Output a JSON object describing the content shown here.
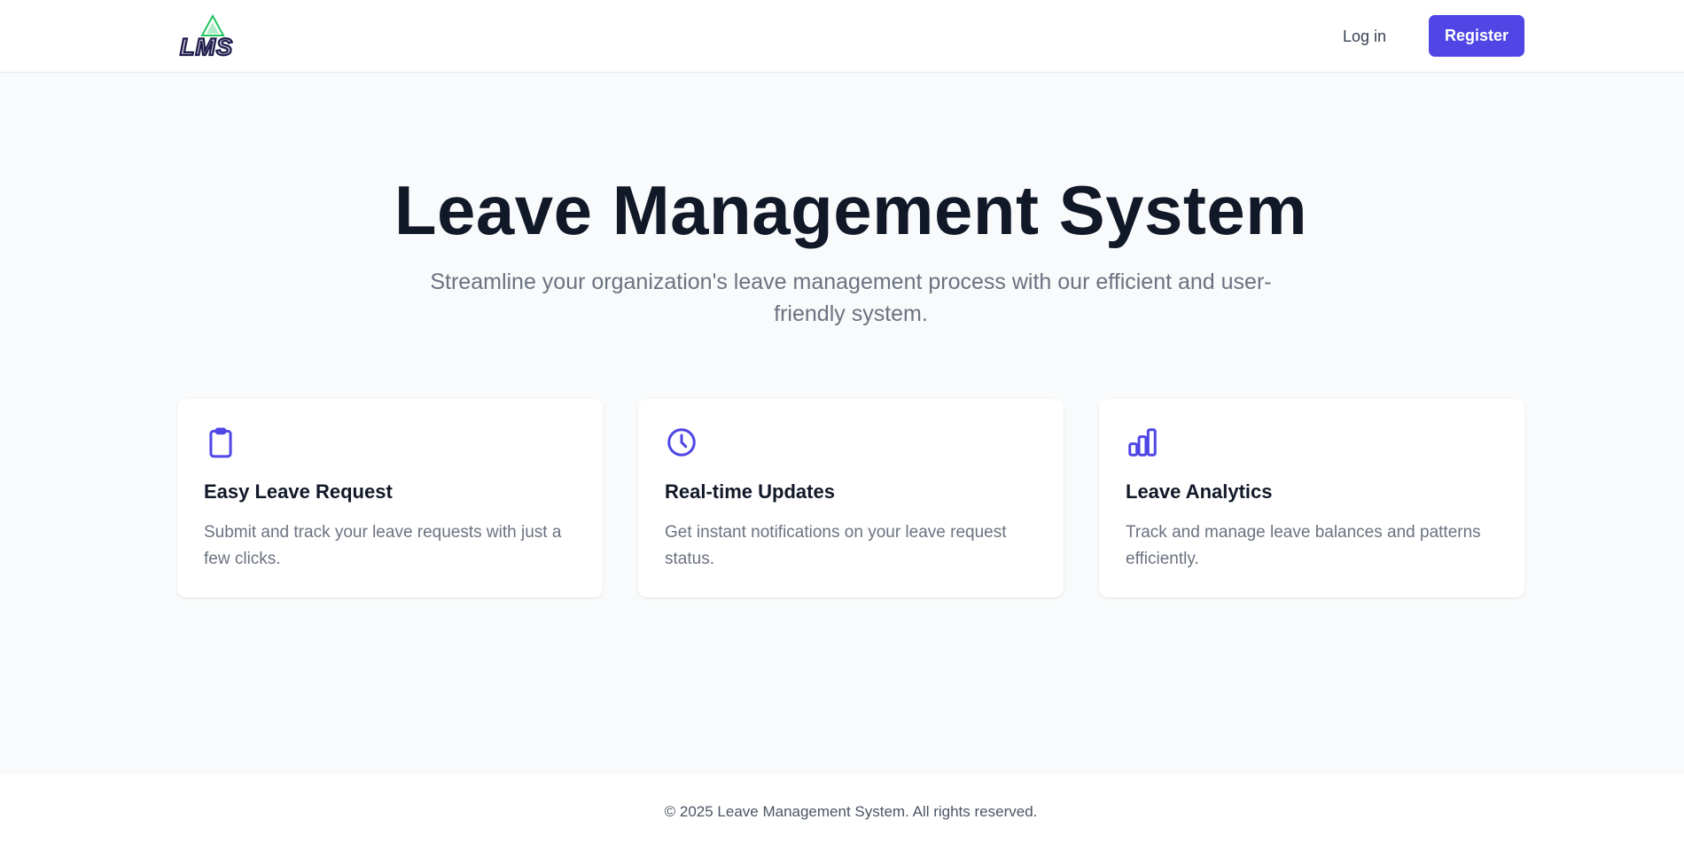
{
  "header": {
    "logo_text": "LMS",
    "login_label": "Log in",
    "register_label": "Register"
  },
  "hero": {
    "title": "Leave Management System",
    "subtitle": "Streamline your organization's leave management process with our efficient and user-friendly system."
  },
  "features": [
    {
      "icon": "clipboard-icon",
      "title": "Easy Leave Request",
      "description": "Submit and track your leave requests with just a few clicks."
    },
    {
      "icon": "clock-icon",
      "title": "Real-time Updates",
      "description": "Get instant notifications on your leave request status."
    },
    {
      "icon": "bar-chart-icon",
      "title": "Leave Analytics",
      "description": "Track and manage leave balances and patterns efficiently."
    }
  ],
  "footer": {
    "text": "© 2025 Leave Management System. All rights reserved."
  },
  "colors": {
    "accent": "#4f46e5",
    "heading": "#111827",
    "muted": "#6b7280",
    "background": "#f9fafb",
    "logo_green": "#22c55e",
    "logo_navy": "#1e1b4b"
  }
}
